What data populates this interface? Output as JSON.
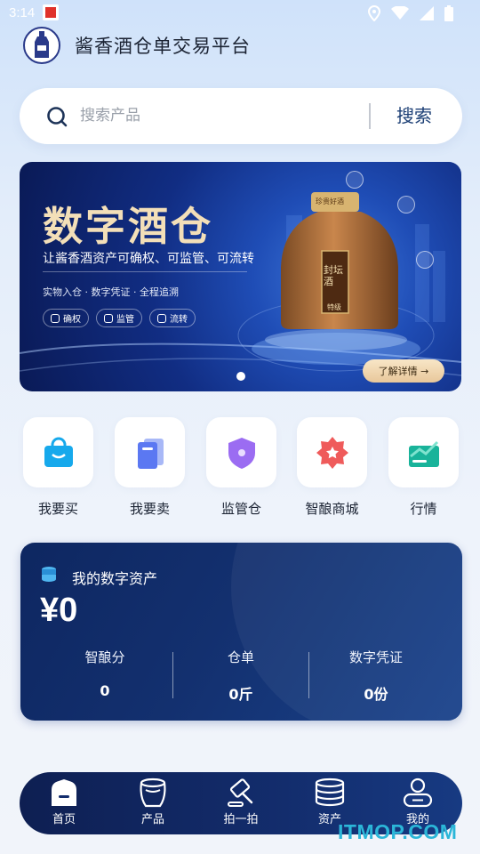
{
  "status_bar": {
    "time": "3:14"
  },
  "header": {
    "title": "酱香酒仓单交易平台"
  },
  "search": {
    "placeholder": "搜索产品",
    "button_label": "搜索"
  },
  "banner": {
    "title": "数字酒仓",
    "subtitle": "让酱香酒资产可确权、可监管、可流转",
    "tagline": "实物入仓 · 数字凭证 · 全程追溯",
    "tags": [
      "确权",
      "监管",
      "流转"
    ],
    "cta_label": "了解详情 →",
    "bottle_label_top": "珍贵好酒",
    "bottle_label_main": "封坛酒",
    "bottle_label_grade": "特级"
  },
  "quick_actions": [
    {
      "label": "我要买",
      "icon": "shopping-bag-icon",
      "color": "#16a9ec"
    },
    {
      "label": "我要卖",
      "icon": "price-tag-icon",
      "color": "#5b78f2"
    },
    {
      "label": "监管仓",
      "icon": "shield-icon",
      "color": "#9b6cf2"
    },
    {
      "label": "智酿商城",
      "icon": "store-badge-icon",
      "color": "#ef5b5b"
    },
    {
      "label": "行情",
      "icon": "trend-chart-icon",
      "color": "#19b39a"
    }
  ],
  "assets": {
    "title": "我的数字资产",
    "total": "¥0",
    "stats": [
      {
        "label": "智酿分",
        "value": "0"
      },
      {
        "label": "仓单",
        "value": "0斤"
      },
      {
        "label": "数字凭证",
        "value": "0份"
      }
    ]
  },
  "tabs": [
    {
      "label": "首页",
      "icon": "home-icon",
      "active": true
    },
    {
      "label": "产品",
      "icon": "jar-icon"
    },
    {
      "label": "拍一拍",
      "icon": "auction-hammer-icon"
    },
    {
      "label": "资产",
      "icon": "coins-stack-icon"
    },
    {
      "label": "我的",
      "icon": "user-icon"
    }
  ],
  "watermark": "ITMOP.COM"
}
